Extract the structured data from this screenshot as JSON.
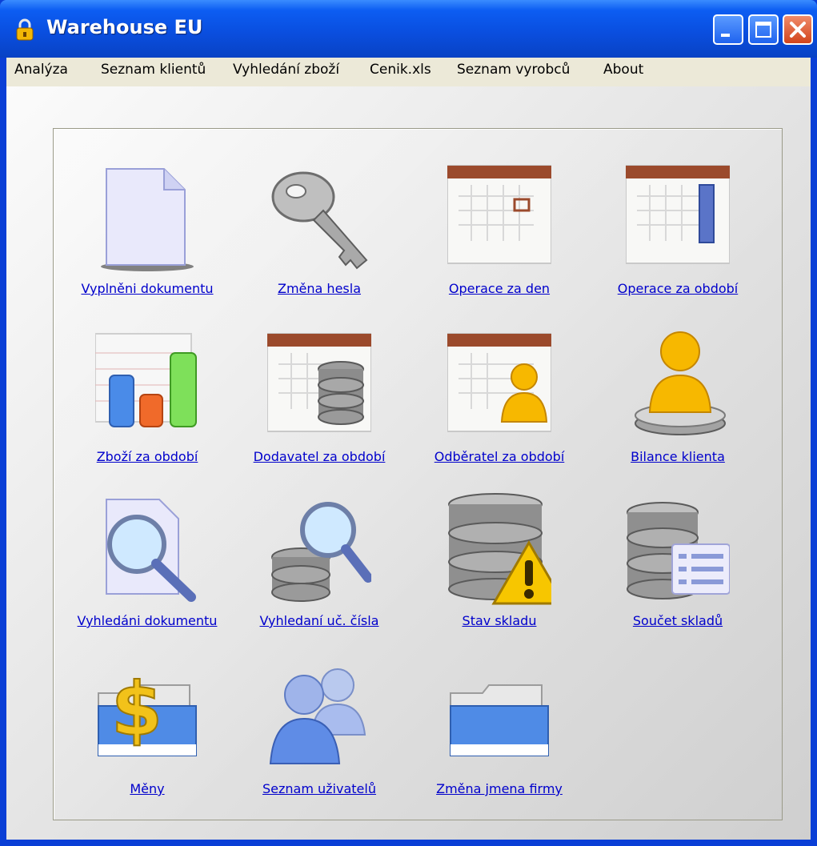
{
  "window": {
    "title": "Warehouse EU"
  },
  "menu": [
    "Analýza",
    "Seznam klientů",
    "Vyhledání zboží",
    "Cenik.xls",
    "Seznam vyrobců",
    "About"
  ],
  "tiles": [
    {
      "label": "Vyplněni dokumentu",
      "icon": "document-icon"
    },
    {
      "label": "Změna hesla",
      "icon": "key-icon"
    },
    {
      "label": "Operace za den",
      "icon": "calendar-day-icon"
    },
    {
      "label": "Operace za období",
      "icon": "calendar-week-icon"
    },
    {
      "label": "Zboží za období",
      "icon": "bar-chart-icon"
    },
    {
      "label": "Dodavatel za období",
      "icon": "calendar-database-icon"
    },
    {
      "label": "Odběratel za období",
      "icon": "calendar-user-icon"
    },
    {
      "label": "Bilance klienta",
      "icon": "user-pedestal-icon"
    },
    {
      "label": "Vyhledáni dokumentu",
      "icon": "document-search-icon"
    },
    {
      "label": "Vyhledaní uč. čísla",
      "icon": "database-search-icon"
    },
    {
      "label": "Stav skladu",
      "icon": "database-warning-icon"
    },
    {
      "label": "Součet skladů",
      "icon": "database-list-icon"
    },
    {
      "label": "Měny",
      "icon": "currency-folder-icon"
    },
    {
      "label": "Seznam uživatelů",
      "icon": "users-icon"
    },
    {
      "label": "Změna jmena firmy",
      "icon": "folder-icon"
    }
  ],
  "colors": {
    "titlebar": "#0a4fe0",
    "link": "#0000cc",
    "menubar": "#ece9d8"
  }
}
